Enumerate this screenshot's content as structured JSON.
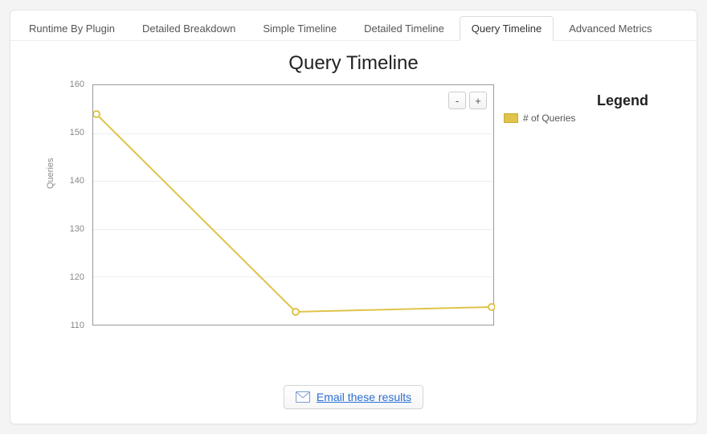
{
  "tabs": {
    "items": [
      "Runtime By Plugin",
      "Detailed Breakdown",
      "Simple Timeline",
      "Detailed Timeline",
      "Query Timeline",
      "Advanced Metrics"
    ],
    "active_index": 4
  },
  "chart": {
    "title": "Query Timeline",
    "ylabel": "Queries",
    "zoom_out": "-",
    "zoom_in": "+"
  },
  "legend": {
    "title": "Legend",
    "series_label": "# of Queries"
  },
  "email": {
    "label": "Email these results"
  },
  "y_ticks": [
    "160",
    "150",
    "140",
    "130",
    "120",
    "110"
  ],
  "chart_data": {
    "type": "line",
    "title": "Query Timeline",
    "xlabel": "",
    "ylabel": "Queries",
    "ylim": [
      110,
      160
    ],
    "series": [
      {
        "name": "# of Queries",
        "values": [
          154,
          113,
          114
        ]
      }
    ],
    "x": [
      0,
      1,
      2
    ],
    "colors": {
      "series_0": "#e0c34a"
    },
    "grid": true,
    "legend_position": "right"
  }
}
